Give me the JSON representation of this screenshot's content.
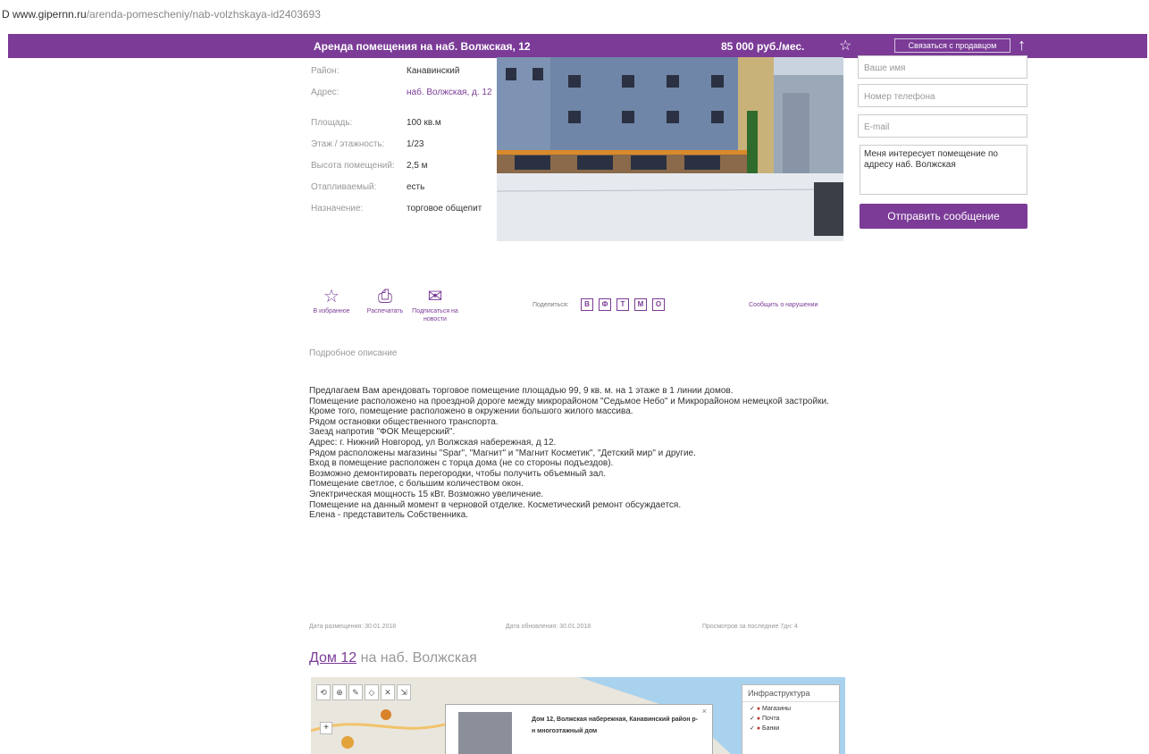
{
  "browser": {
    "url_host": "D www.gipernn.ru",
    "url_path": "/arenda-pomescheniy/nab-volzhskaya-id2403693"
  },
  "header": {
    "title": "Аренда помещения на наб. Волжская, 12",
    "price": "85 000 руб./мес.",
    "call_button": "Связаться с продавцом",
    "accent": "#7b3b97"
  },
  "properties": [
    {
      "key": "Район:",
      "value": "Канавинский",
      "link": false
    },
    {
      "key": "Адрес:",
      "value": "наб. Волжская, д. 12",
      "link": true
    },
    {
      "key": "Площадь:",
      "value": "100 кв.м",
      "link": false
    },
    {
      "key": "Этаж / этажность:",
      "value": "1/23",
      "link": false
    },
    {
      "key": "Высота помещений:",
      "value": "2,5 м",
      "link": false
    },
    {
      "key": "Отапливаемый:",
      "value": "есть",
      "link": false
    },
    {
      "key": "Назначение:",
      "value": "торговое общепит",
      "link": false
    }
  ],
  "form": {
    "name_placeholder": "Ваше имя",
    "phone_placeholder": "Номер телефона",
    "email_placeholder": "E-mail",
    "message": "Меня интересует помещение по адресу наб. Волжская",
    "send_button": "Отправить сообщение"
  },
  "tools": {
    "favorites": "В избранное",
    "print": "Распечатать",
    "subscribe": "Подписаться на новости",
    "share_label": "Поделиться:",
    "share_buttons": [
      "В",
      "Ф",
      "Т",
      "М",
      "О"
    ],
    "report": "Сообщить о нарушении"
  },
  "description": {
    "heading": "Подробное описание",
    "lines": [
      "Предлагаем Вам арендовать торговое помещение площадью 99, 9 кв. м. на 1 этаже в 1 линии домов.",
      "Помещение расположено на проездной дороге между микрорайоном \"Седьмое Небо\" и Микрорайоном немецкой застройки.",
      "Кроме того, помещение расположено в окружении большого жилого массива.",
      "Рядом остановки общественного транспорта.",
      "Заезд напротив \"ФОК Мещерский\".",
      "Адрес: г. Нижний Новгород, ул Волжская набережная, д 12.",
      "Рядом расположены магазины \"Spar\", \"Магнит\" и \"Магнит Косметик\", \"Детский мир\" и другие.",
      "Вход в помещение расположен с торца дома (не со стороны подъездов).",
      "Возможно демонтировать перегородки, чтобы получить объемный зал.",
      "Помещение светлое, с большим количеством окон.",
      "Электрическая мощность 15 кВт. Возможно увеличение.",
      "Помещение на данный момент в черновой отделке. Косметический ремонт обсуждается.",
      "Елена - представитель Собственника."
    ]
  },
  "meta": {
    "published": "Дата размещения: 30.01.2018",
    "updated": "Дата обновления: 30.01.2018",
    "views": "Просмотров за последние 7дн: 4"
  },
  "house": {
    "link": "Дом 12",
    "rest": " на наб. Волжская"
  },
  "map": {
    "popup": "Дом 12, Волжская набережная, Канавинский район р-н многоэтажный дом",
    "infra_title": "Инфраструктура",
    "infra_items": [
      "Магазины",
      "Почта",
      "Банки"
    ],
    "tool_labels": [
      "⟲",
      "⊕",
      "✎",
      "◇",
      "✕",
      "⇲"
    ]
  }
}
